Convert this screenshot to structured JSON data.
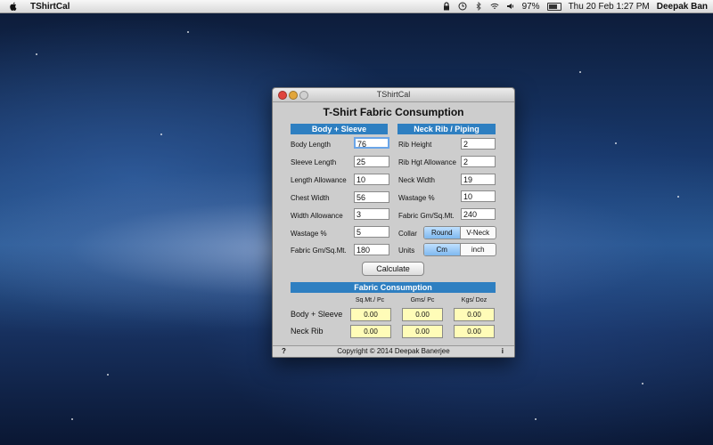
{
  "menubar": {
    "app_name": "TShirtCal",
    "battery": "97%",
    "datetime": "Thu 20 Feb  1:27 PM",
    "user": "Deepak Ban"
  },
  "window": {
    "title": "TShirtCal",
    "heading": "T-Shirt Fabric Consumption"
  },
  "body_sleeve": {
    "header": "Body + Sleeve",
    "fields": [
      {
        "label": "Body Length",
        "value": "76"
      },
      {
        "label": "Sleeve Length",
        "value": "25"
      },
      {
        "label": "Length Allowance",
        "value": "10"
      },
      {
        "label": "Chest Width",
        "value": "56"
      },
      {
        "label": "Width Allowance",
        "value": "3"
      },
      {
        "label": "Wastage %",
        "value": "5"
      },
      {
        "label": "Fabric Gm/Sq.Mt.",
        "value": "180"
      }
    ]
  },
  "neck_rib": {
    "header": "Neck Rib / Piping",
    "fields": [
      {
        "label": "Rib Height",
        "value": "2"
      },
      {
        "label": "Rib Hgt Allowance",
        "value": "2"
      },
      {
        "label": "Neck Width",
        "value": "19"
      },
      {
        "label": "Wastage %",
        "value": "10"
      },
      {
        "label": "Fabric Gm/Sq.Mt.",
        "value": "240"
      }
    ],
    "collar": {
      "label": "Collar",
      "options": [
        "Round",
        "V-Neck"
      ],
      "selected": "Round"
    },
    "units": {
      "label": "Units",
      "options": [
        "Cm",
        "inch"
      ],
      "selected": "Cm"
    }
  },
  "calculate_label": "Calculate",
  "results": {
    "header": "Fabric Consumption",
    "columns": [
      "Sq.Mt./ Pc",
      "Gms/ Pc",
      "Kgs/ Doz"
    ],
    "rows": [
      {
        "label": "Body + Sleeve",
        "values": [
          "0.00",
          "0.00",
          "0.00"
        ]
      },
      {
        "label": "Neck Rib",
        "values": [
          "0.00",
          "0.00",
          "0.00"
        ]
      }
    ]
  },
  "status": {
    "help": "?",
    "copyright": "Copyright © 2014  Deepak Banerjee",
    "info": "i"
  }
}
